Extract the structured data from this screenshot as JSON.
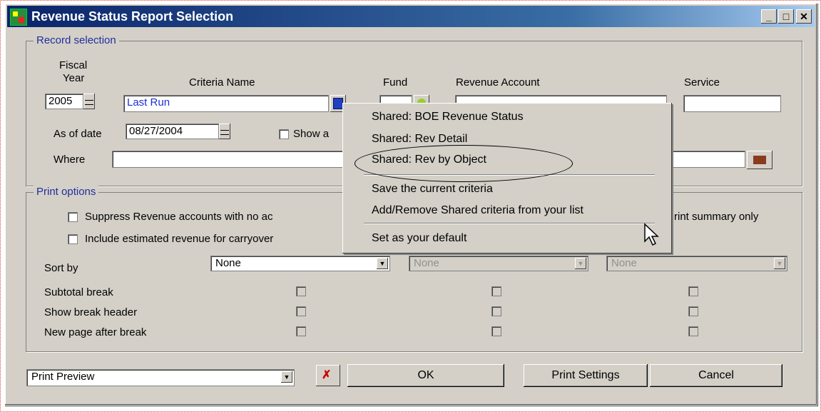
{
  "window": {
    "title": "Revenue Status Report Selection",
    "minimize": "_",
    "maximize": "□",
    "close": "✕"
  },
  "record_selection": {
    "legend": "Record selection",
    "fiscal_label_1": "Fiscal",
    "fiscal_label_2": "Year",
    "fiscal_year": "2005",
    "criteria_label": "Criteria Name",
    "criteria_value": "Last Run",
    "fund_label": "Fund",
    "fund_value": "",
    "revenue_label": "Revenue Account",
    "revenue_value": "",
    "service_label": "Service",
    "service_value": "",
    "asof_label": "As of date",
    "asof_value": "08/27/2004",
    "show_label": "Show a",
    "where_label": "Where",
    "where_value": ""
  },
  "print_options": {
    "legend": "Print options",
    "suppress_label": "Suppress Revenue accounts with no ac",
    "include_label": "Include estimated revenue for carryover",
    "summary_label": "rint summary only",
    "sort_label": "Sort by",
    "sort1": "None",
    "sort2": "None",
    "sort3": "None",
    "subtotal_label": "Subtotal break",
    "header_label": "Show break header",
    "newpage_label": "New page after break"
  },
  "footer": {
    "output_value": "Print Preview",
    "ok_label": "OK",
    "print_settings_label": "Print Settings",
    "cancel_label": "Cancel"
  },
  "context_menu": {
    "items": [
      "Shared: BOE Revenue Status",
      "Shared: Rev Detail",
      "Shared: Rev by Object",
      "Save the current criteria",
      "Add/Remove Shared criteria from your list",
      "Set as your default"
    ]
  }
}
